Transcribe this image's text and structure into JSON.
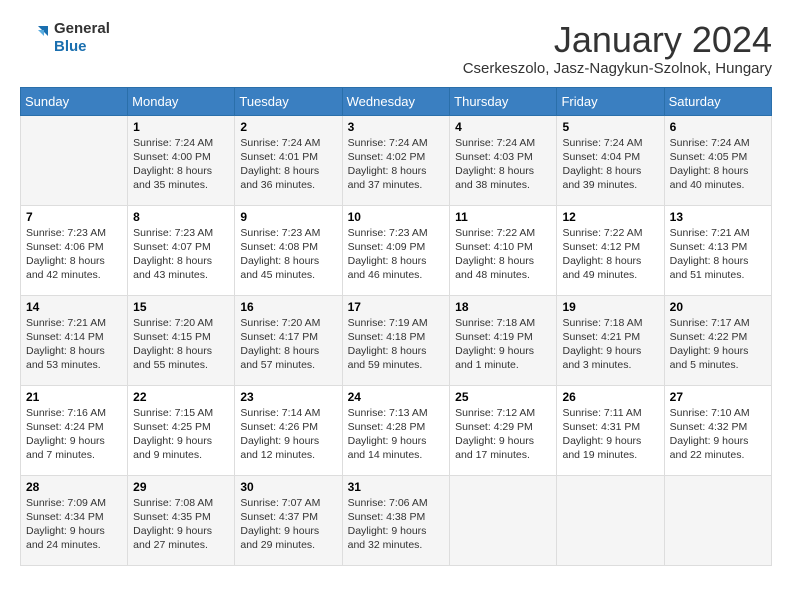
{
  "header": {
    "logo_general": "General",
    "logo_blue": "Blue",
    "month_title": "January 2024",
    "location": "Cserkeszolo, Jasz-Nagykun-Szolnok, Hungary"
  },
  "days_of_week": [
    "Sunday",
    "Monday",
    "Tuesday",
    "Wednesday",
    "Thursday",
    "Friday",
    "Saturday"
  ],
  "weeks": [
    [
      {
        "day": "",
        "sunrise": "",
        "sunset": "",
        "daylight": ""
      },
      {
        "day": "1",
        "sunrise": "7:24 AM",
        "sunset": "4:00 PM",
        "daylight": "8 hours and 35 minutes."
      },
      {
        "day": "2",
        "sunrise": "7:24 AM",
        "sunset": "4:01 PM",
        "daylight": "8 hours and 36 minutes."
      },
      {
        "day": "3",
        "sunrise": "7:24 AM",
        "sunset": "4:02 PM",
        "daylight": "8 hours and 37 minutes."
      },
      {
        "day": "4",
        "sunrise": "7:24 AM",
        "sunset": "4:03 PM",
        "daylight": "8 hours and 38 minutes."
      },
      {
        "day": "5",
        "sunrise": "7:24 AM",
        "sunset": "4:04 PM",
        "daylight": "8 hours and 39 minutes."
      },
      {
        "day": "6",
        "sunrise": "7:24 AM",
        "sunset": "4:05 PM",
        "daylight": "8 hours and 40 minutes."
      }
    ],
    [
      {
        "day": "7",
        "sunrise": "7:23 AM",
        "sunset": "4:06 PM",
        "daylight": "8 hours and 42 minutes."
      },
      {
        "day": "8",
        "sunrise": "7:23 AM",
        "sunset": "4:07 PM",
        "daylight": "8 hours and 43 minutes."
      },
      {
        "day": "9",
        "sunrise": "7:23 AM",
        "sunset": "4:08 PM",
        "daylight": "8 hours and 45 minutes."
      },
      {
        "day": "10",
        "sunrise": "7:23 AM",
        "sunset": "4:09 PM",
        "daylight": "8 hours and 46 minutes."
      },
      {
        "day": "11",
        "sunrise": "7:22 AM",
        "sunset": "4:10 PM",
        "daylight": "8 hours and 48 minutes."
      },
      {
        "day": "12",
        "sunrise": "7:22 AM",
        "sunset": "4:12 PM",
        "daylight": "8 hours and 49 minutes."
      },
      {
        "day": "13",
        "sunrise": "7:21 AM",
        "sunset": "4:13 PM",
        "daylight": "8 hours and 51 minutes."
      }
    ],
    [
      {
        "day": "14",
        "sunrise": "7:21 AM",
        "sunset": "4:14 PM",
        "daylight": "8 hours and 53 minutes."
      },
      {
        "day": "15",
        "sunrise": "7:20 AM",
        "sunset": "4:15 PM",
        "daylight": "8 hours and 55 minutes."
      },
      {
        "day": "16",
        "sunrise": "7:20 AM",
        "sunset": "4:17 PM",
        "daylight": "8 hours and 57 minutes."
      },
      {
        "day": "17",
        "sunrise": "7:19 AM",
        "sunset": "4:18 PM",
        "daylight": "8 hours and 59 minutes."
      },
      {
        "day": "18",
        "sunrise": "7:18 AM",
        "sunset": "4:19 PM",
        "daylight": "9 hours and 1 minute."
      },
      {
        "day": "19",
        "sunrise": "7:18 AM",
        "sunset": "4:21 PM",
        "daylight": "9 hours and 3 minutes."
      },
      {
        "day": "20",
        "sunrise": "7:17 AM",
        "sunset": "4:22 PM",
        "daylight": "9 hours and 5 minutes."
      }
    ],
    [
      {
        "day": "21",
        "sunrise": "7:16 AM",
        "sunset": "4:24 PM",
        "daylight": "9 hours and 7 minutes."
      },
      {
        "day": "22",
        "sunrise": "7:15 AM",
        "sunset": "4:25 PM",
        "daylight": "9 hours and 9 minutes."
      },
      {
        "day": "23",
        "sunrise": "7:14 AM",
        "sunset": "4:26 PM",
        "daylight": "9 hours and 12 minutes."
      },
      {
        "day": "24",
        "sunrise": "7:13 AM",
        "sunset": "4:28 PM",
        "daylight": "9 hours and 14 minutes."
      },
      {
        "day": "25",
        "sunrise": "7:12 AM",
        "sunset": "4:29 PM",
        "daylight": "9 hours and 17 minutes."
      },
      {
        "day": "26",
        "sunrise": "7:11 AM",
        "sunset": "4:31 PM",
        "daylight": "9 hours and 19 minutes."
      },
      {
        "day": "27",
        "sunrise": "7:10 AM",
        "sunset": "4:32 PM",
        "daylight": "9 hours and 22 minutes."
      }
    ],
    [
      {
        "day": "28",
        "sunrise": "7:09 AM",
        "sunset": "4:34 PM",
        "daylight": "9 hours and 24 minutes."
      },
      {
        "day": "29",
        "sunrise": "7:08 AM",
        "sunset": "4:35 PM",
        "daylight": "9 hours and 27 minutes."
      },
      {
        "day": "30",
        "sunrise": "7:07 AM",
        "sunset": "4:37 PM",
        "daylight": "9 hours and 29 minutes."
      },
      {
        "day": "31",
        "sunrise": "7:06 AM",
        "sunset": "4:38 PM",
        "daylight": "9 hours and 32 minutes."
      },
      {
        "day": "",
        "sunrise": "",
        "sunset": "",
        "daylight": ""
      },
      {
        "day": "",
        "sunrise": "",
        "sunset": "",
        "daylight": ""
      },
      {
        "day": "",
        "sunrise": "",
        "sunset": "",
        "daylight": ""
      }
    ]
  ]
}
